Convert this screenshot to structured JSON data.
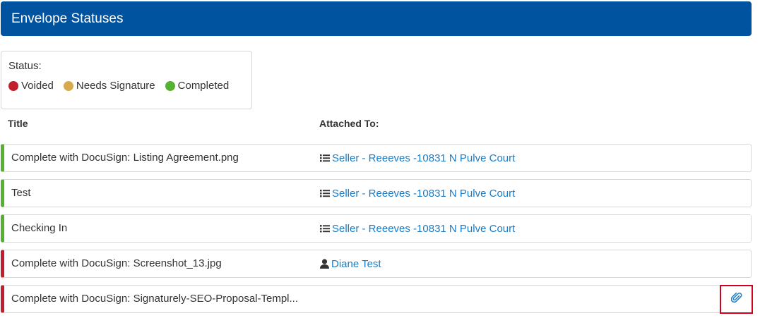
{
  "header": {
    "title": "Envelope Statuses"
  },
  "legend": {
    "label": "Status:",
    "items": [
      {
        "label": "Voided",
        "color": "#c0202e"
      },
      {
        "label": "Needs Signature",
        "color": "#d9a94e"
      },
      {
        "label": "Completed",
        "color": "#55b230"
      }
    ]
  },
  "columns": {
    "title": "Title",
    "attached": "Attached To:"
  },
  "rows": [
    {
      "title": "Complete with DocuSign: Listing Agreement.png",
      "status": "completed",
      "status_color": "#55b230",
      "attached_icon": "list-icon",
      "attached": "Seller - Reeeves -10831 N Pulve Court"
    },
    {
      "title": "Test",
      "status": "completed",
      "status_color": "#55b230",
      "attached_icon": "list-icon",
      "attached": "Seller - Reeeves -10831 N Pulve Court"
    },
    {
      "title": "Checking In",
      "status": "completed",
      "status_color": "#55b230",
      "attached_icon": "list-icon",
      "attached": "Seller - Reeeves -10831 N Pulve Court"
    },
    {
      "title": "Complete with DocuSign: Screenshot_13.jpg",
      "status": "voided",
      "status_color": "#c0202e",
      "attached_icon": "user-icon",
      "attached": "Diane Test"
    },
    {
      "title": "Complete with DocuSign: Signaturely-SEO-Proposal-Templ...",
      "status": "voided",
      "status_color": "#c0202e",
      "attached_icon": "paperclip-icon",
      "attached": ""
    }
  ],
  "colors": {
    "header_bg": "#00549f",
    "link": "#1a7bc4",
    "highlight": "#d0021b"
  }
}
